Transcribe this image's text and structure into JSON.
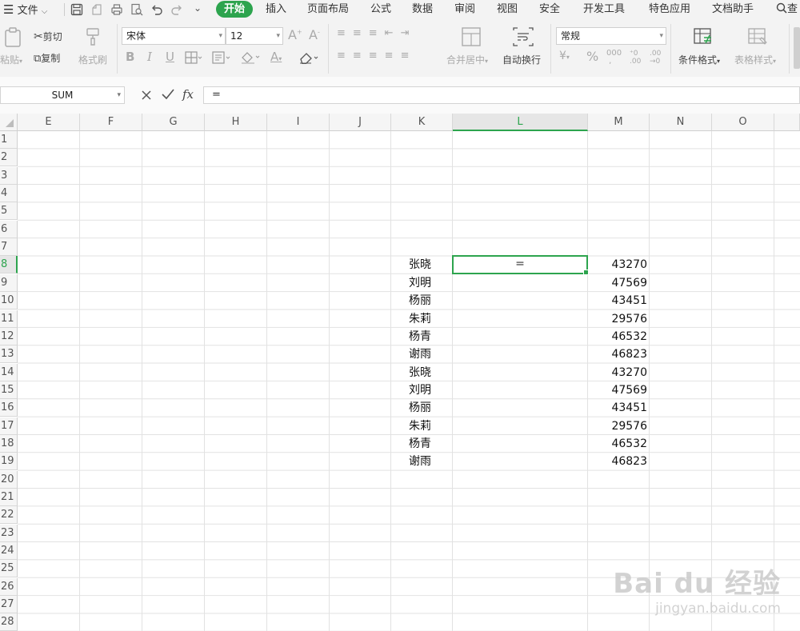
{
  "menu": {
    "file_label": "文件",
    "tabs": [
      "开始",
      "插入",
      "页面布局",
      "公式",
      "数据",
      "审阅",
      "视图",
      "安全",
      "开发工具",
      "特色应用",
      "文档助手"
    ],
    "search_label": "查"
  },
  "ribbon": {
    "paste_label": "粘贴",
    "cut_label": "剪切",
    "copy_label": "复制",
    "format_painter_label": "格式刷",
    "font_name": "宋体",
    "font_size": "12",
    "merge_center_label": "合并居中",
    "wrap_text_label": "自动换行",
    "number_format": "常规",
    "conditional_format_label": "条件格式",
    "table_style_label": "表格样式"
  },
  "formula_bar": {
    "name_box": "SUM",
    "fx_label": "fx",
    "formula": "="
  },
  "sheet": {
    "columns": [
      "E",
      "F",
      "G",
      "H",
      "I",
      "J",
      "K",
      "L",
      "M",
      "N",
      "O"
    ],
    "rows": [
      "1",
      "2",
      "3",
      "4",
      "5",
      "6",
      "7",
      "8",
      "9",
      "10",
      "11",
      "12",
      "13",
      "14",
      "15",
      "16",
      "17",
      "18",
      "19",
      "20",
      "21",
      "22",
      "23",
      "24",
      "25",
      "26",
      "27",
      "28"
    ],
    "active_column": "L",
    "active_row": "8",
    "active_cell_value": "=",
    "data_rows": [
      {
        "row": "8",
        "name": "张晓",
        "value": "43270"
      },
      {
        "row": "9",
        "name": "刘明",
        "value": "47569"
      },
      {
        "row": "10",
        "name": "杨丽",
        "value": "43451"
      },
      {
        "row": "11",
        "name": "朱莉",
        "value": "29576"
      },
      {
        "row": "12",
        "name": "杨青",
        "value": "46532"
      },
      {
        "row": "13",
        "name": "谢雨",
        "value": "46823"
      },
      {
        "row": "14",
        "name": "张晓",
        "value": "43270"
      },
      {
        "row": "15",
        "name": "刘明",
        "value": "47569"
      },
      {
        "row": "16",
        "name": "杨丽",
        "value": "43451"
      },
      {
        "row": "17",
        "name": "朱莉",
        "value": "29576"
      },
      {
        "row": "18",
        "name": "杨青",
        "value": "46532"
      },
      {
        "row": "19",
        "name": "谢雨",
        "value": "46823"
      }
    ]
  },
  "watermark": {
    "brand": "Bai du 经验",
    "url": "jingyan.baidu.com"
  },
  "colors": {
    "accent": "#2da44e",
    "gridline": "#e2e2e2",
    "header_bg": "#f5f5f5"
  }
}
